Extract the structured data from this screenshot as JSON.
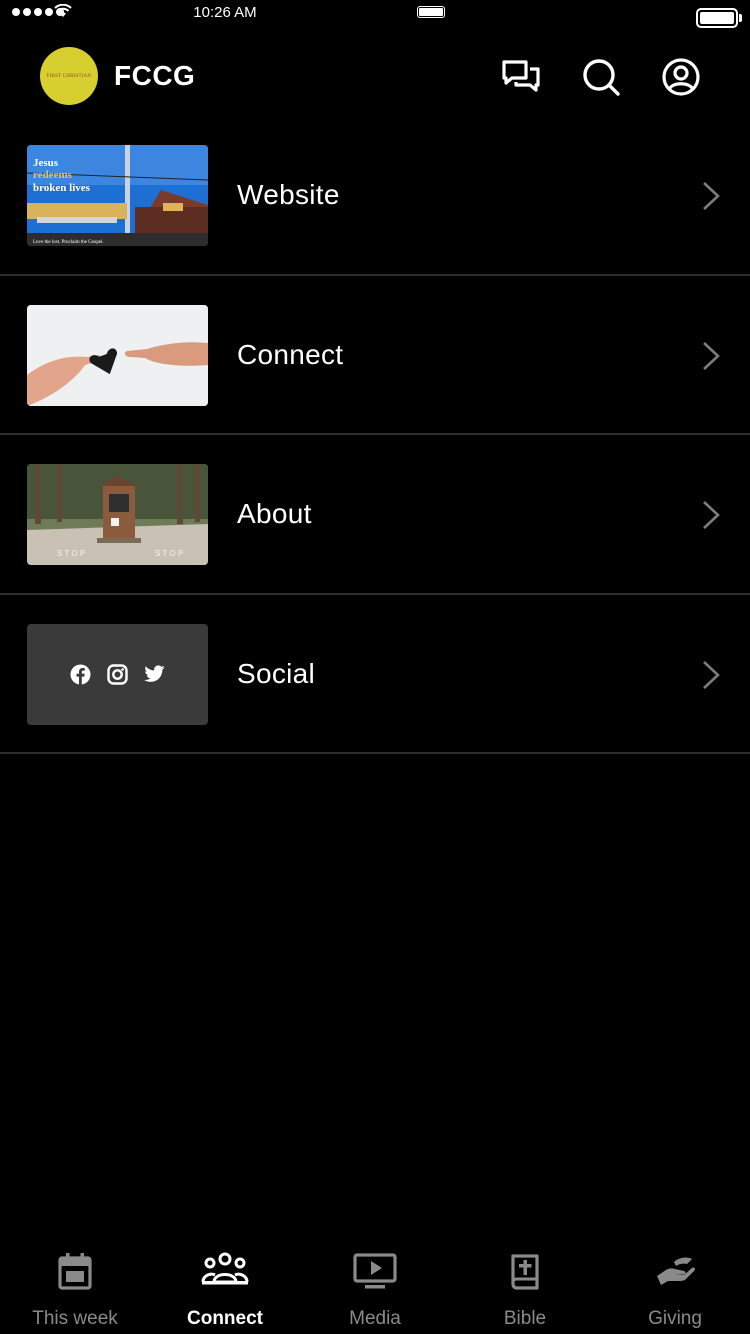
{
  "status_bar": {
    "time": "10:26 AM"
  },
  "header": {
    "title": "FCCG",
    "logo_text": "FIRST CHRISTIAN"
  },
  "website_thumb": {
    "line1": "Jesus",
    "line2": "redeems",
    "line3": "broken lives",
    "caption": "Love the lost. Proclaim the Gospel."
  },
  "rows": [
    {
      "label": "Website"
    },
    {
      "label": "Connect"
    },
    {
      "label": "About"
    },
    {
      "label": "Social"
    }
  ],
  "tabs": [
    {
      "label": "This week"
    },
    {
      "label": "Connect"
    },
    {
      "label": "Media"
    },
    {
      "label": "Bible"
    },
    {
      "label": "Giving"
    }
  ],
  "active_tab": "Connect",
  "colors": {
    "background": "#000000",
    "logo": "#d6cf2f",
    "inactive_tab": "#8a8a8a",
    "divider": "#2e2e2e"
  },
  "icons": {
    "chat": "chat-bubbles-icon",
    "search": "search-icon",
    "profile": "user-circle-icon",
    "chevron": "chevron-right-icon"
  }
}
